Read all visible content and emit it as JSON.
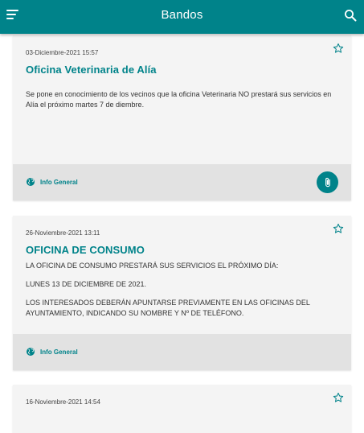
{
  "appbar": {
    "title": "Bandos"
  },
  "cards": [
    {
      "date": "03-Diciembre-2021 15:57",
      "title": "Oficina Veterinaria de Alía",
      "body": [
        "Se pone en conocimiento de los vecinos que la oficina Veterinaria NO prestará sus servicios en Alía el próximo martes 7 de diembre."
      ],
      "category": "Info General"
    },
    {
      "date": "26-Noviembre-2021 13:11",
      "title": "OFICINA DE CONSUMO",
      "body": [
        "LA OFICINA DE CONSUMO PRESTARÁ SUS SERVICIOS EL PRÓXIMO DÍA:",
        " LUNES 13 DE DICIEMBRE DE 2021.",
        " LOS INTERESADOS DEBERÁN APUNTARSE PREVIAMENTE EN LAS OFICINAS DEL AYUNTAMIENTO, INDICANDO SU NOMBRE Y Nº DE TELÉFONO."
      ],
      "category": "Info General"
    },
    {
      "date": "16-Noviembre-2021 14:54"
    }
  ],
  "colors": {
    "primary": "#00838a",
    "card_bg": "#f4f4f4",
    "footer_bg": "#e2e2e2"
  }
}
